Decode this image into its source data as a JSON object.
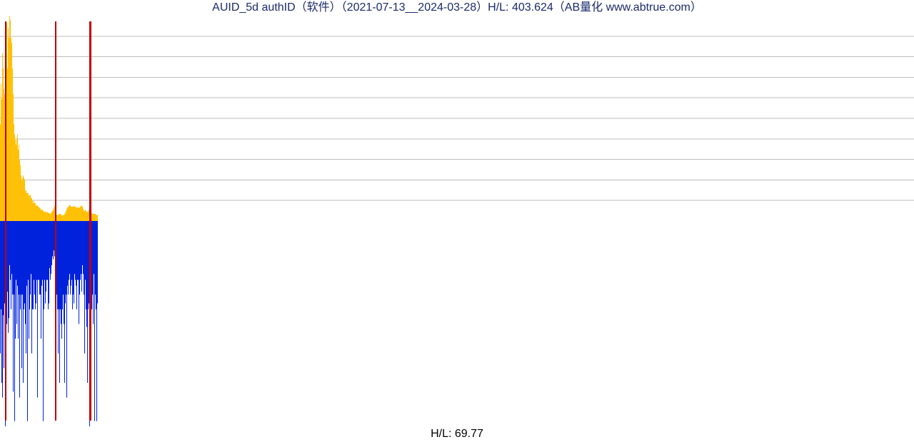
{
  "title": "AUID_5d authID（软件）（2021-07-13__2024-03-28）H/L: 403.624（AB量化  www.abtrue.com）",
  "footer": "H/L: 69.77",
  "chart_data": {
    "type": "bar",
    "title": "AUID_5d authID（软件）（2021-07-13__2024-03-28）H/L: 403.624（AB量化  www.abtrue.com）",
    "xlabel": "",
    "ylabel": "",
    "ylim_upper": [
      0,
      403.624
    ],
    "ylim_lower": [
      0,
      69.77
    ],
    "x_range": [
      "2021-07-13",
      "2024-03-28"
    ],
    "n_bars": 137,
    "gridlines_upper": 9,
    "annotations": [
      "H/L: 403.624",
      "H/L: 69.77"
    ],
    "red_spike_indices": [
      7,
      8,
      77,
      78,
      125,
      126,
      127
    ],
    "series": [
      {
        "name": "upper",
        "color": "#ffc107",
        "baseline": 0,
        "values": [
          190,
          270,
          240,
          330,
          300,
          260,
          250,
          290,
          310,
          390,
          300,
          380,
          360,
          403,
          395,
          360,
          350,
          300,
          250,
          190,
          170,
          160,
          150,
          160,
          170,
          140,
          150,
          120,
          110,
          90,
          80,
          85,
          90,
          85,
          80,
          60,
          60,
          55,
          55,
          55,
          50,
          50,
          52,
          45,
          45,
          40,
          35,
          40,
          35,
          35,
          30,
          32,
          30,
          28,
          28,
          25,
          25,
          22,
          22,
          22,
          20,
          18,
          18,
          18,
          18,
          16,
          18,
          16,
          16,
          14,
          14,
          16,
          18,
          20,
          22,
          26,
          30,
          80,
          50,
          12,
          12,
          12,
          14,
          14,
          14,
          12,
          12,
          10,
          12,
          12,
          14,
          16,
          20,
          24,
          26,
          28,
          30,
          32,
          30,
          28,
          28,
          28,
          28,
          30,
          28,
          28,
          28,
          26,
          26,
          28,
          26,
          26,
          28,
          30,
          30,
          28,
          24,
          20,
          20,
          22,
          20,
          18,
          18,
          18,
          22,
          50,
          40,
          18,
          16,
          14,
          14,
          14,
          14,
          14,
          12,
          12,
          12
        ]
      },
      {
        "name": "lower",
        "color": "#0022dd",
        "baseline": 0,
        "values": [
          45,
          30,
          55,
          60,
          32,
          50,
          28,
          70,
          25,
          35,
          24,
          38,
          33,
          15,
          20,
          30,
          18,
          25,
          58,
          25,
          68,
          40,
          20,
          35,
          22,
          40,
          25,
          60,
          30,
          25,
          50,
          25,
          55,
          30,
          28,
          35,
          45,
          22,
          68,
          20,
          40,
          30,
          25,
          18,
          45,
          30,
          30,
          20,
          25,
          30,
          28,
          20,
          60,
          20,
          20,
          25,
          25,
          40,
          22,
          20,
          68,
          30,
          20,
          28,
          24,
          20,
          20,
          30,
          28,
          16,
          20,
          18,
          15,
          12,
          13,
          10,
          12,
          15,
          10,
          25,
          30,
          45,
          30,
          55,
          30,
          35,
          40,
          30,
          25,
          35,
          55,
          28,
          25,
          60,
          22,
          25,
          20,
          18,
          25,
          22,
          20,
          30,
          25,
          28,
          18,
          20,
          22,
          30,
          20,
          20,
          35,
          25,
          20,
          18,
          24,
          15,
          18,
          25,
          45,
          20,
          30,
          36,
          55,
          30,
          28,
          70,
          35,
          55,
          30,
          25,
          35,
          18,
          68,
          25,
          30,
          68,
          28
        ]
      }
    ]
  }
}
